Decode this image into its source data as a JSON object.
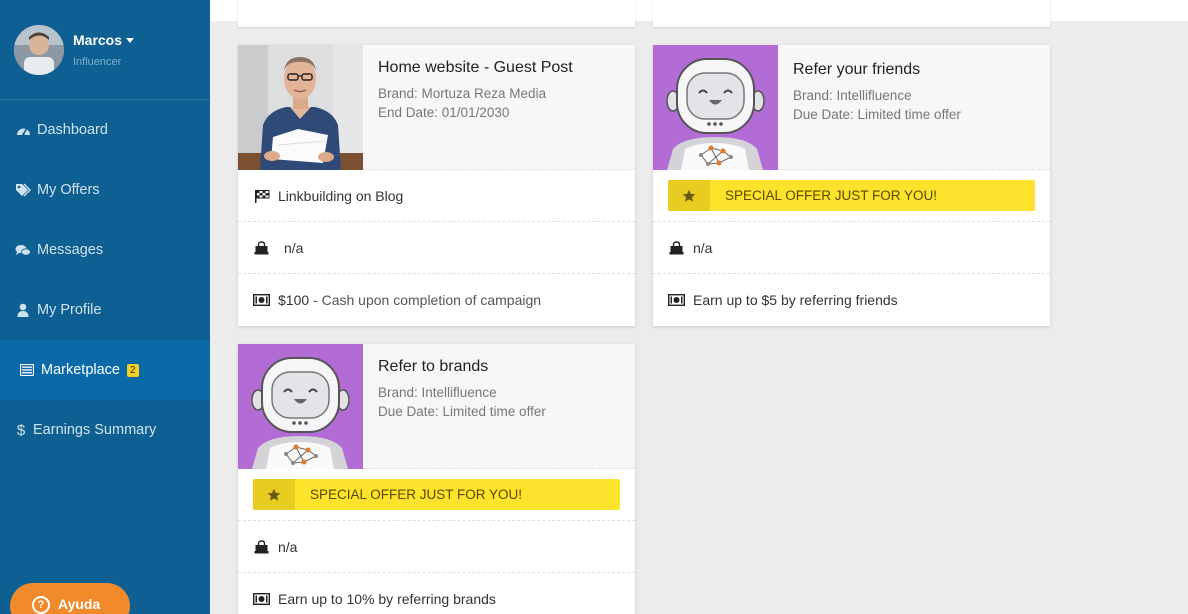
{
  "user": {
    "name": "Marcos",
    "role": "Influencer"
  },
  "nav": [
    {
      "label": "Dashboard",
      "icon": "dashboard-icon"
    },
    {
      "label": "My Offers",
      "icon": "tags-icon"
    },
    {
      "label": "Messages",
      "icon": "comments-icon"
    },
    {
      "label": "My Profile",
      "icon": "user-icon"
    },
    {
      "label": "Marketplace",
      "icon": "list-icon",
      "badge": "2",
      "active": true
    },
    {
      "label": "Earnings Summary",
      "icon": "dollar-icon"
    }
  ],
  "help": {
    "label": "Ayuda"
  },
  "cards": [
    {
      "title": "Home website - Guest Post",
      "brand": "Brand: Mortuza Reza Media",
      "date": "End Date: 01/01/2030",
      "category": "Linkbuilding on Blog",
      "product": "n/a",
      "payment_amount": "$100",
      "payment_desc": " - Cash upon completion of campaign"
    },
    {
      "title": "Refer your friends",
      "brand": "Brand: Intellifluence",
      "date": "Due Date: Limited time offer",
      "special": "SPECIAL OFFER JUST FOR YOU!",
      "product": "n/a",
      "payment": "Earn up to $5 by referring friends"
    },
    {
      "title": "Refer to brands",
      "brand": "Brand: Intellifluence",
      "date": "Due Date: Limited time offer",
      "special": "SPECIAL OFFER JUST FOR YOU!",
      "product": "n/a",
      "payment": "Earn up to 10% by referring brands"
    }
  ],
  "colors": {
    "sidebar": "#0e5f92",
    "active_nav": "#0a6aa8",
    "badge": "#f5d01f",
    "special_offer": "#fde32b",
    "help_button": "#f08a2b",
    "robot_bg": "#b36bd6"
  }
}
